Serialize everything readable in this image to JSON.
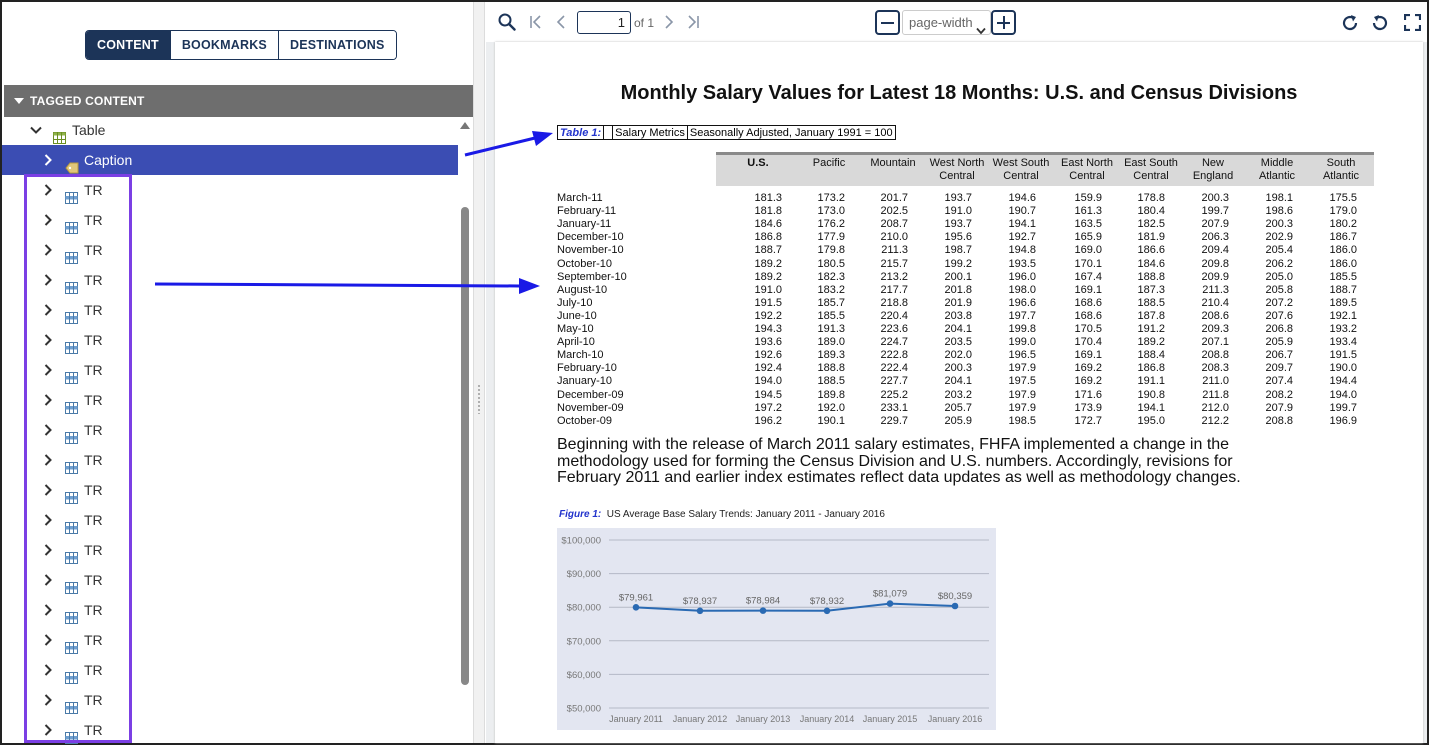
{
  "left_panel": {
    "tabs": [
      {
        "label": "CONTENT",
        "active": true
      },
      {
        "label": "BOOKMARKS",
        "active": false
      },
      {
        "label": "DESTINATIONS",
        "active": false
      }
    ],
    "section_title": "TAGGED CONTENT",
    "tree": {
      "table_label": "Table",
      "caption_label": "Caption",
      "row_label": "TR"
    }
  },
  "toolbar": {
    "page_value": "1",
    "page_of": "of 1",
    "zoom_value": "page-width",
    "icons": [
      "search-icon",
      "first-page-icon",
      "previous-page-icon",
      "next-page-icon",
      "last-page-icon",
      "zoom-out-icon",
      "zoom-in-icon",
      "rotate-clockwise-icon",
      "rotate-counterclockwise-icon",
      "fullscreen-icon"
    ]
  },
  "document": {
    "title": "Monthly Salary Values for Latest 18 Months: U.S. and Census Divisions",
    "caption_label": "Table 1:",
    "caption_name": "Salary Metrics",
    "caption_note": "Seasonally Adjusted, January 1991 = 100",
    "columns": [
      [
        "U.S.",
        ""
      ],
      [
        "Pacific",
        ""
      ],
      [
        "Mountain",
        ""
      ],
      [
        "West North",
        "Central"
      ],
      [
        "West South",
        "Central"
      ],
      [
        "East North",
        "Central"
      ],
      [
        "East South",
        "Central"
      ],
      [
        "New",
        "England"
      ],
      [
        "Middle",
        "Atlantic"
      ],
      [
        "South",
        "Atlantic"
      ]
    ],
    "rows": [
      [
        "March-11",
        "181.3",
        "173.2",
        "201.7",
        "193.7",
        "194.6",
        "159.9",
        "178.8",
        "200.3",
        "198.1",
        "175.5"
      ],
      [
        "February-11",
        "181.8",
        "173.0",
        "202.5",
        "191.0",
        "190.7",
        "161.3",
        "180.4",
        "199.7",
        "198.6",
        "179.0"
      ],
      [
        "January-11",
        "184.6",
        "176.2",
        "208.7",
        "193.7",
        "194.1",
        "163.5",
        "182.5",
        "207.9",
        "200.3",
        "180.2"
      ],
      [
        "December-10",
        "186.8",
        "177.9",
        "210.0",
        "195.6",
        "192.7",
        "165.9",
        "181.9",
        "206.3",
        "202.9",
        "186.7"
      ],
      [
        "November-10",
        "188.7",
        "179.8",
        "211.3",
        "198.7",
        "194.8",
        "169.0",
        "186.6",
        "209.4",
        "205.4",
        "186.0"
      ],
      [
        "October-10",
        "189.2",
        "180.5",
        "215.7",
        "199.2",
        "193.5",
        "170.1",
        "184.6",
        "209.8",
        "206.2",
        "186.0"
      ],
      [
        "September-10",
        "189.2",
        "182.3",
        "213.2",
        "200.1",
        "196.0",
        "167.4",
        "188.8",
        "209.9",
        "205.0",
        "185.5"
      ],
      [
        "August-10",
        "191.0",
        "183.2",
        "217.7",
        "201.8",
        "198.0",
        "169.1",
        "187.3",
        "211.3",
        "205.8",
        "188.7"
      ],
      [
        "July-10",
        "191.5",
        "185.7",
        "218.8",
        "201.9",
        "196.6",
        "168.6",
        "188.5",
        "210.4",
        "207.2",
        "189.5"
      ],
      [
        "June-10",
        "192.2",
        "185.5",
        "220.4",
        "203.8",
        "197.7",
        "168.6",
        "187.8",
        "208.6",
        "207.6",
        "192.1"
      ],
      [
        "May-10",
        "194.3",
        "191.3",
        "223.6",
        "204.1",
        "199.8",
        "170.5",
        "191.2",
        "209.3",
        "206.8",
        "193.2"
      ],
      [
        "April-10",
        "193.6",
        "189.0",
        "224.7",
        "203.5",
        "199.0",
        "170.4",
        "189.2",
        "207.1",
        "205.9",
        "193.4"
      ],
      [
        "March-10",
        "192.6",
        "189.3",
        "222.8",
        "202.0",
        "196.5",
        "169.1",
        "188.4",
        "208.8",
        "206.7",
        "191.5"
      ],
      [
        "February-10",
        "192.4",
        "188.8",
        "222.4",
        "200.3",
        "197.9",
        "169.2",
        "186.8",
        "208.3",
        "209.7",
        "190.0"
      ],
      [
        "January-10",
        "194.0",
        "188.5",
        "227.7",
        "204.1",
        "197.5",
        "169.2",
        "191.1",
        "211.0",
        "207.4",
        "194.4"
      ],
      [
        "December-09",
        "194.5",
        "189.8",
        "225.2",
        "203.2",
        "197.9",
        "171.6",
        "190.8",
        "211.8",
        "208.2",
        "194.0"
      ],
      [
        "November-09",
        "197.2",
        "192.0",
        "233.1",
        "205.7",
        "197.9",
        "173.9",
        "194.1",
        "212.0",
        "207.9",
        "199.7"
      ],
      [
        "October-09",
        "196.2",
        "190.1",
        "229.7",
        "205.9",
        "198.5",
        "172.7",
        "195.0",
        "212.2",
        "208.8",
        "196.9"
      ]
    ],
    "paragraph": "Beginning with the release of March 2011 salary estimates, FHFA implemented a change in the methodology used for forming the Census Division and U.S. numbers. Accordingly, revisions for February 2011 and earlier index estimates reflect data updates as well as methodology changes.",
    "figure_label": "Figure 1:",
    "figure_title": "US Average Base Salary Trends: January 2011 - January 2016"
  },
  "colors": {
    "accent": "#1c3458",
    "selected_row": "#3b4db3",
    "annotation_arrow": "#1a1ae6",
    "annotation_box": "#7b3fe4",
    "series_line": "#2a6ab3",
    "chart_bg": "#e3e6f1"
  },
  "chart_data": {
    "type": "line",
    "title": "US Average Base Salary Trends: January 2011 - January 2016",
    "categories": [
      "January 2011",
      "January 2012",
      "January 2013",
      "January 2014",
      "January 2015",
      "January 2016"
    ],
    "series": [
      {
        "values": [
          79961,
          78937,
          78984,
          78932,
          81079,
          80359
        ]
      }
    ],
    "data_labels": [
      "$79,961",
      "$78,937",
      "$78,984",
      "$78,932",
      "$81,079",
      "$80,359"
    ],
    "y_ticks": [
      "$100,000",
      "$90,000",
      "$80,000",
      "$70,000",
      "$60,000",
      "$50,000"
    ],
    "y_tick_values": [
      100000,
      90000,
      80000,
      70000,
      60000,
      50000
    ],
    "ylim": [
      50000,
      100000
    ],
    "grid": true
  }
}
